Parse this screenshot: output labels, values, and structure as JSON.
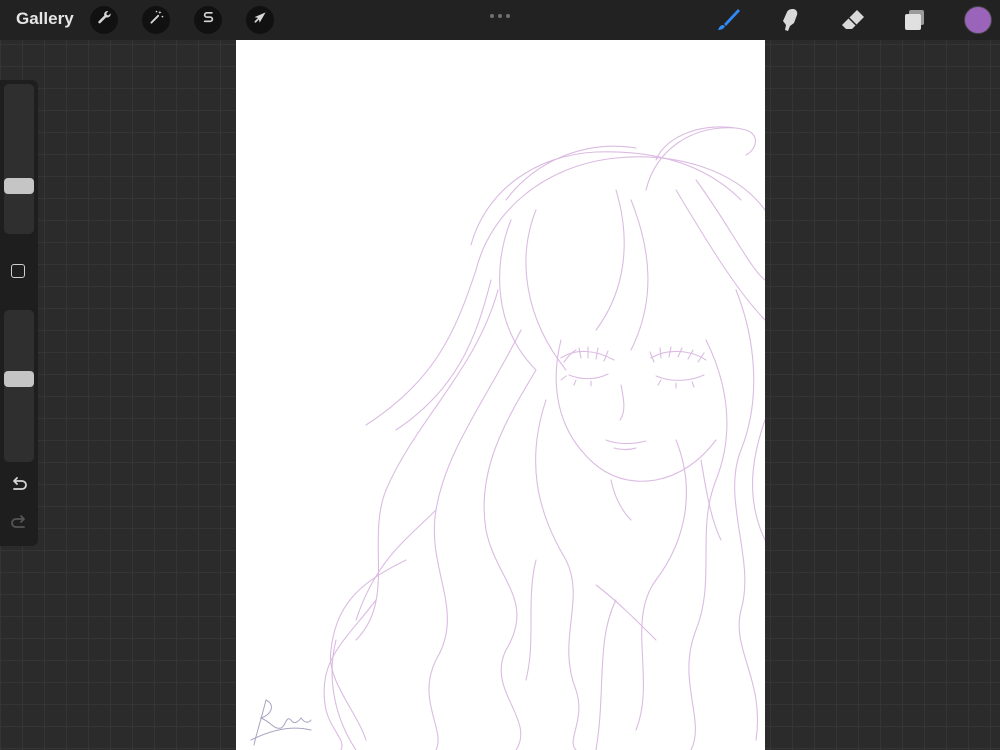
{
  "topbar": {
    "gallery_label": "Gallery",
    "actions_icon": "wrench-icon",
    "adjustments_icon": "magic-wand-icon",
    "selection_icon": "selection-s-icon",
    "transform_icon": "arrow-cursor-icon"
  },
  "tools": {
    "brush_icon": "brush-icon",
    "smudge_icon": "smudge-icon",
    "eraser_icon": "eraser-icon",
    "layers_icon": "layers-icon",
    "accent_color": "#2f8af5",
    "current_color": "#9a64bb"
  },
  "sidebar": {
    "brush_size_level": 0.3,
    "opacity_level": 0.55,
    "modify_icon": "square-modify-icon",
    "undo_icon": "undo-icon",
    "redo_icon": "redo-icon"
  },
  "canvas": {
    "background": "#ffffff",
    "stroke_color": "#d8b4df",
    "content": "sketch-of-girl-with-long-wavy-hair",
    "signature_icon": "artist-signature"
  }
}
